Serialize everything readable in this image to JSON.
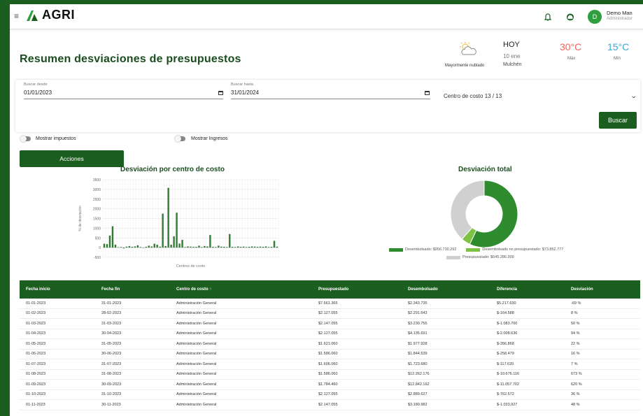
{
  "app": {
    "brand": "AGRI",
    "user_name": "Demo Man",
    "user_role": "Administrador",
    "avatar_letter": "D"
  },
  "page": {
    "title": "Resumen desviaciones de presupuestos"
  },
  "weather": {
    "description": "Mayormente nublado",
    "today": "HOY",
    "date": "10 ene",
    "location": "Mulchén",
    "max": "30°C",
    "max_label": "Máx",
    "min": "15°C",
    "min_label": "Mín"
  },
  "filters": {
    "from_label": "Buscar desde",
    "from_value": "01/01/2023",
    "to_label": "Buscar hasta",
    "to_value": "31/01/2024",
    "cost_center": "Centro de costo 13 / 13",
    "search_button": "Buscar"
  },
  "toggles": {
    "taxes": "Mostrar impuestos",
    "income": "Mostrar Ingresos"
  },
  "actions_button": "Acciones",
  "chart_data": [
    {
      "type": "bar",
      "title": "Desviación por centro de costo",
      "xlabel": "Centros de costo",
      "ylabel": "% de desviación",
      "ylim": [
        -500,
        3500
      ],
      "yticks": [
        -500,
        0,
        500,
        1000,
        1500,
        2000,
        2500,
        3000,
        3500
      ],
      "grid": true,
      "values": [
        200,
        180,
        620,
        1100,
        150,
        20,
        30,
        -40,
        50,
        80,
        40,
        60,
        120,
        30,
        -20,
        40,
        100,
        60,
        200,
        150,
        50,
        1750,
        80,
        3080,
        150,
        580,
        1800,
        210,
        400,
        30,
        60,
        50,
        40,
        40,
        100,
        30,
        80,
        60,
        650,
        40,
        30,
        100,
        50,
        40,
        30,
        700,
        40,
        30,
        60,
        40,
        50,
        30,
        40,
        60,
        50,
        40,
        50,
        40,
        60,
        30,
        40,
        350,
        50
      ]
    },
    {
      "type": "pie",
      "title": "Desviación total",
      "labels": [
        "Desembolsado",
        "Desembolsado no presupuestado",
        "Presupuestado"
      ],
      "values": [
        956730292,
        73852777,
        645286909
      ],
      "colors": [
        "#2e8b2e",
        "#7dc242",
        "#d0d0d0"
      ],
      "legend_texts": [
        "Desembolsado: $956.730.292",
        "Desembolsado no presupuestado: $73.852.777",
        "Presupuestado: $645.286.909"
      ]
    }
  ],
  "table": {
    "headers": [
      "Fecha inicio",
      "Fecha fin",
      "Centro de costo ↑",
      "Presupuestado",
      "Desembolsado",
      "Diferencia",
      "Desviación"
    ],
    "rows": [
      [
        "01-01-2023",
        "31-01-2023",
        "Administración General",
        "$7.561.365",
        "$2.343.735",
        "$5.217.630",
        "-69 %"
      ],
      [
        "01-02-2023",
        "28-02-2023",
        "Administración General",
        "$2.127.055",
        "$2.291.643",
        "$-164.588",
        "8 %"
      ],
      [
        "01-03-2023",
        "31-03-2023",
        "Administración General",
        "$2.147.055",
        "$3.230.755",
        "$-1.083.700",
        "50 %"
      ],
      [
        "01-04-2023",
        "30-04-2023",
        "Administración General",
        "$2.127.055",
        "$4.135.691",
        "$-2.008.636",
        "94 %"
      ],
      [
        "01-05-2023",
        "31-05-2023",
        "Administración General",
        "$1.621.060",
        "$1.977.928",
        "$-356.868",
        "22 %"
      ],
      [
        "01-06-2023",
        "30-06-2023",
        "Administración General",
        "$1.586.060",
        "$1.844.539",
        "$-258.479",
        "16 %"
      ],
      [
        "01-07-2023",
        "31-07-2023",
        "Administración General",
        "$1.606.060",
        "$1.723.680",
        "$-117.620",
        "7 %"
      ],
      [
        "01-08-2023",
        "31-08-2023",
        "Administración General",
        "$1.586.060",
        "$12.262.176",
        "$-10.676.116",
        "673 %"
      ],
      [
        "01-09-2023",
        "30-09-2023",
        "Administración General",
        "$1.784.460",
        "$12.842.162",
        "$-11.057.702",
        "620 %"
      ],
      [
        "01-10-2023",
        "31-10-2023",
        "Administración General",
        "$2.127.055",
        "$2.889.627",
        "$-762.572",
        "36 %"
      ],
      [
        "01-11-2023",
        "30-11-2023",
        "Administración General",
        "$2.147.055",
        "$3.180.982",
        "$-1.033.927",
        "48 %"
      ]
    ]
  }
}
